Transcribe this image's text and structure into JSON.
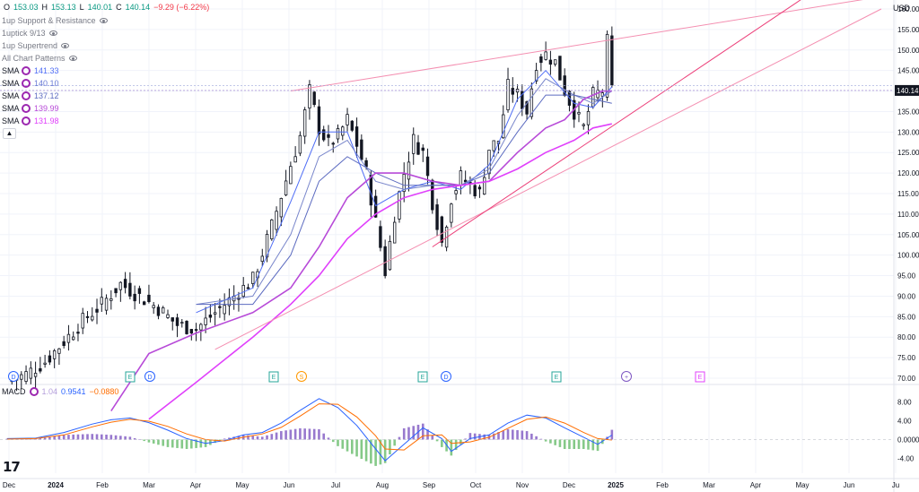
{
  "header": {
    "open_label": "O",
    "open": "153.03",
    "high_label": "H",
    "high": "153.13",
    "low_label": "L",
    "low": "140.01",
    "close_label": "C",
    "close": "140.14",
    "change": "−9.29 (−6.22%)",
    "currency": "USD"
  },
  "indicators": [
    {
      "label": "1up Support & Resistance",
      "icon": "eye-icon"
    },
    {
      "label": "1uptick 9/13",
      "icon": "eye-icon"
    },
    {
      "label": "1up Supertrend",
      "icon": "eye-icon"
    },
    {
      "label": "All Chart Patterns",
      "icon": "eye-icon"
    }
  ],
  "sma": [
    {
      "name": "SMA",
      "value": "141.33",
      "color": "#4f6df5"
    },
    {
      "name": "SMA",
      "value": "140.10",
      "color": "#6a7bd6"
    },
    {
      "name": "SMA",
      "value": "137.12",
      "color": "#5c6bc0"
    },
    {
      "name": "SMA",
      "value": "139.99",
      "color": "#b74ad8"
    },
    {
      "name": "SMA",
      "value": "131.98",
      "color": "#e040fb"
    }
  ],
  "collapse_icon": "chevron-up-icon",
  "macd": {
    "name": "MACD",
    "hist": "1.04",
    "macd": "0.9541",
    "signal": "−0.0880",
    "hist_color": "#b39ddb",
    "macd_color": "#2962ff",
    "signal_color": "#ff6d00"
  },
  "price_label": {
    "value": "140.14",
    "color": "#131722"
  },
  "logo": "17",
  "colors": {
    "up": "#131722",
    "trendline": "#f48fb1",
    "trendline_dark": "#ec407a",
    "grid": "#f0f3fa",
    "bg": "#ffffff"
  },
  "chart_data": {
    "type": "candlestick",
    "title": "",
    "y_axis": {
      "min": 70,
      "max": 160,
      "ticks": [
        160,
        155,
        150,
        145,
        140,
        135,
        130,
        125,
        120,
        115,
        110,
        105,
        100,
        95,
        90,
        85,
        80,
        75,
        70
      ],
      "tick_labels": [
        "160.00",
        "155.00",
        "150.00",
        "145.00",
        "140.00",
        "135.00",
        "130.00",
        "125.00",
        "120.00",
        "115.00",
        "110.00",
        "105.00",
        "100.00",
        "95.00",
        "90.00",
        "85.00",
        "80.00",
        "75.00",
        "70.00"
      ]
    },
    "x_axis": {
      "labels": [
        "Dec",
        "2024",
        "Feb",
        "Mar",
        "Apr",
        "May",
        "Jun",
        "Jul",
        "Aug",
        "Sep",
        "Oct",
        "Nov",
        "Dec",
        "2025",
        "Feb",
        "Mar",
        "Apr",
        "May",
        "Jun",
        "Ju"
      ]
    },
    "price_series_close": [
      [
        0,
        69
      ],
      [
        4,
        71
      ],
      [
        8,
        74
      ],
      [
        12,
        79
      ],
      [
        16,
        84
      ],
      [
        20,
        88
      ],
      [
        24,
        93
      ],
      [
        28,
        90
      ],
      [
        32,
        87
      ],
      [
        36,
        83
      ],
      [
        40,
        82
      ],
      [
        44,
        86
      ],
      [
        48,
        90
      ],
      [
        52,
        94
      ],
      [
        56,
        107
      ],
      [
        60,
        122
      ],
      [
        62,
        129
      ],
      [
        64,
        140
      ],
      [
        66,
        131
      ],
      [
        68,
        127
      ],
      [
        70,
        129
      ],
      [
        72,
        133
      ],
      [
        74,
        127
      ],
      [
        76,
        120
      ],
      [
        78,
        108
      ],
      [
        80,
        96
      ],
      [
        82,
        110
      ],
      [
        84,
        120
      ],
      [
        86,
        128
      ],
      [
        88,
        125
      ],
      [
        90,
        113
      ],
      [
        92,
        103
      ],
      [
        94,
        114
      ],
      [
        96,
        119
      ],
      [
        98,
        117
      ],
      [
        100,
        115
      ],
      [
        102,
        126
      ],
      [
        104,
        128
      ],
      [
        106,
        141
      ],
      [
        108,
        139
      ],
      [
        110,
        135
      ],
      [
        112,
        147
      ],
      [
        114,
        149
      ],
      [
        116,
        147
      ],
      [
        118,
        140
      ],
      [
        120,
        135
      ],
      [
        122,
        131
      ],
      [
        124,
        139
      ],
      [
        126,
        140
      ],
      [
        127,
        152
      ],
      [
        128,
        140.14
      ]
    ],
    "sma_series": [
      {
        "name": "",
        "color": "#4f6df5",
        "values": [
          [
            40,
            86
          ],
          [
            52,
            92
          ],
          [
            60,
            113
          ],
          [
            66,
            130
          ],
          [
            72,
            130
          ],
          [
            78,
            112
          ],
          [
            84,
            116
          ],
          [
            90,
            118
          ],
          [
            96,
            116
          ],
          [
            102,
            122
          ],
          [
            108,
            138
          ],
          [
            114,
            145
          ],
          [
            120,
            137
          ],
          [
            124,
            136
          ],
          [
            128,
            141
          ]
        ]
      },
      {
        "name": "",
        "color": "#7986cb",
        "values": [
          [
            40,
            88
          ],
          [
            52,
            90
          ],
          [
            60,
            105
          ],
          [
            66,
            124
          ],
          [
            72,
            128
          ],
          [
            78,
            118
          ],
          [
            84,
            116
          ],
          [
            90,
            117
          ],
          [
            96,
            117
          ],
          [
            102,
            121
          ],
          [
            108,
            134
          ],
          [
            114,
            143
          ],
          [
            120,
            139
          ],
          [
            124,
            137
          ],
          [
            128,
            140
          ]
        ]
      },
      {
        "name": "",
        "color": "#5c6bc0",
        "values": [
          [
            40,
            88
          ],
          [
            52,
            88
          ],
          [
            60,
            100
          ],
          [
            66,
            118
          ],
          [
            72,
            124
          ],
          [
            78,
            120
          ],
          [
            84,
            117
          ],
          [
            90,
            117
          ],
          [
            96,
            117
          ],
          [
            102,
            120
          ],
          [
            108,
            130
          ],
          [
            114,
            139
          ],
          [
            120,
            139
          ],
          [
            124,
            138
          ],
          [
            128,
            137
          ]
        ]
      },
      {
        "name": "",
        "color": "#b74ad8",
        "values": [
          [
            22,
            62
          ],
          [
            30,
            76
          ],
          [
            40,
            81
          ],
          [
            52,
            86
          ],
          [
            60,
            92
          ],
          [
            66,
            102
          ],
          [
            72,
            114
          ],
          [
            78,
            120
          ],
          [
            84,
            120
          ],
          [
            90,
            118
          ],
          [
            96,
            117
          ],
          [
            102,
            118
          ],
          [
            108,
            125
          ],
          [
            114,
            131
          ],
          [
            118,
            133
          ],
          [
            122,
            138
          ],
          [
            126,
            140
          ],
          [
            128,
            140
          ]
        ]
      },
      {
        "name": "",
        "color": "#e040fb",
        "values": [
          [
            30,
            60
          ],
          [
            40,
            69
          ],
          [
            52,
            80
          ],
          [
            60,
            88
          ],
          [
            66,
            95
          ],
          [
            72,
            104
          ],
          [
            78,
            110
          ],
          [
            84,
            114
          ],
          [
            90,
            116
          ],
          [
            96,
            117
          ],
          [
            102,
            118
          ],
          [
            108,
            121
          ],
          [
            114,
            125
          ],
          [
            120,
            128
          ],
          [
            124,
            131
          ],
          [
            128,
            132
          ]
        ]
      }
    ],
    "trendlines": [
      {
        "from": [
          44,
          77
        ],
        "to": [
          185,
          160
        ],
        "color": "#f48fb1"
      },
      {
        "from": [
          60,
          140
        ],
        "to": [
          185,
          163
        ],
        "color": "#f48fb1"
      },
      {
        "from": [
          90,
          102
        ],
        "to": [
          178,
          170
        ],
        "color": "#ec407a"
      }
    ],
    "event_markers": [
      "D",
      "E",
      "D",
      "E",
      "S",
      "E",
      "D",
      "E",
      "+",
      "E"
    ],
    "macd_axis": {
      "ticks": [
        8,
        4,
        0,
        -4
      ],
      "tick_labels": [
        "8.00",
        "4.00",
        "0.0000",
        "-4.00"
      ],
      "min": -6,
      "max": 10
    },
    "macd_line": [
      [
        0,
        0.2
      ],
      [
        6,
        0.3
      ],
      [
        12,
        1.5
      ],
      [
        18,
        3.3
      ],
      [
        22,
        4.2
      ],
      [
        26,
        4.6
      ],
      [
        30,
        3.6
      ],
      [
        34,
        2.0
      ],
      [
        38,
        0.2
      ],
      [
        42,
        -0.8
      ],
      [
        46,
        -0.2
      ],
      [
        50,
        1.0
      ],
      [
        54,
        1.5
      ],
      [
        58,
        3.5
      ],
      [
        62,
        6.2
      ],
      [
        66,
        8.7
      ],
      [
        70,
        6.8
      ],
      [
        74,
        3.0
      ],
      [
        78,
        -2.0
      ],
      [
        80,
        -4.5
      ],
      [
        84,
        -1.0
      ],
      [
        88,
        2.5
      ],
      [
        92,
        0.2
      ],
      [
        94,
        -2.5
      ],
      [
        98,
        0.2
      ],
      [
        102,
        1.0
      ],
      [
        106,
        3.5
      ],
      [
        110,
        5.2
      ],
      [
        114,
        4.6
      ],
      [
        118,
        2.5
      ],
      [
        122,
        0.5
      ],
      [
        125,
        -1.0
      ],
      [
        128,
        0.95
      ]
    ],
    "macd_signal": [
      [
        0,
        0.1
      ],
      [
        6,
        0.2
      ],
      [
        12,
        1.0
      ],
      [
        18,
        2.7
      ],
      [
        22,
        3.7
      ],
      [
        26,
        4.3
      ],
      [
        30,
        3.9
      ],
      [
        34,
        2.8
      ],
      [
        38,
        1.2
      ],
      [
        42,
        0.0
      ],
      [
        46,
        -0.3
      ],
      [
        50,
        0.5
      ],
      [
        54,
        1.2
      ],
      [
        58,
        2.6
      ],
      [
        62,
        5.0
      ],
      [
        66,
        7.6
      ],
      [
        70,
        7.5
      ],
      [
        74,
        4.8
      ],
      [
        78,
        0.8
      ],
      [
        80,
        -2.0
      ],
      [
        84,
        -2.2
      ],
      [
        88,
        0.8
      ],
      [
        92,
        1.0
      ],
      [
        94,
        -0.8
      ],
      [
        98,
        -0.5
      ],
      [
        102,
        0.5
      ],
      [
        106,
        2.4
      ],
      [
        110,
        4.3
      ],
      [
        114,
        4.8
      ],
      [
        118,
        3.5
      ],
      [
        122,
        1.5
      ],
      [
        125,
        0.2
      ],
      [
        128,
        -0.09
      ]
    ],
    "legend": [
      "MACD"
    ]
  }
}
